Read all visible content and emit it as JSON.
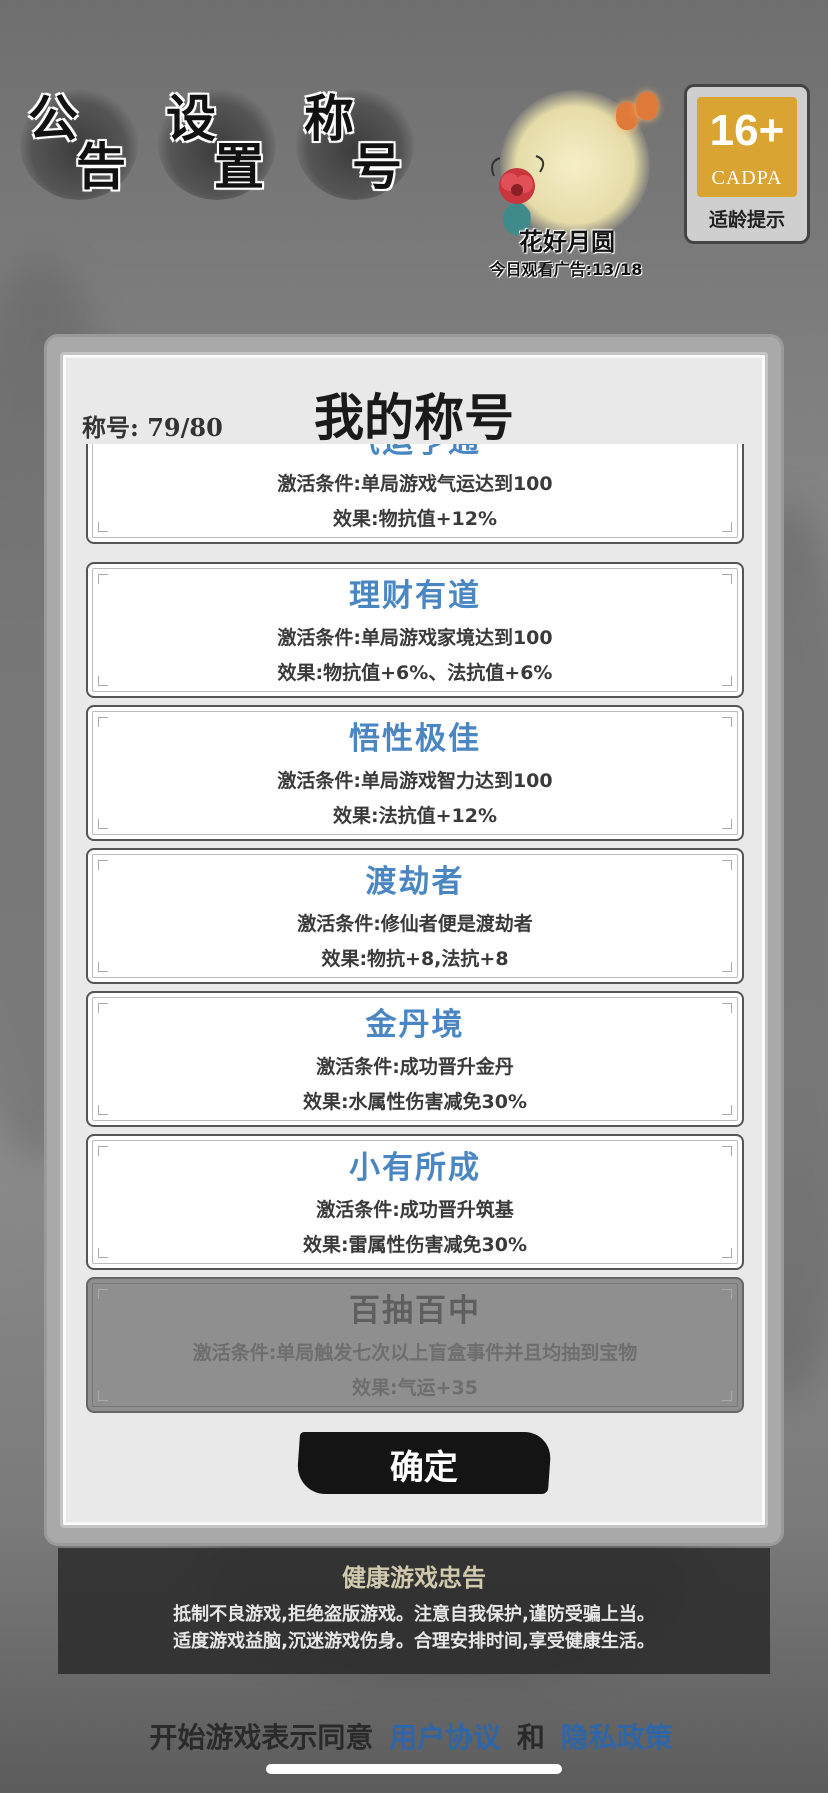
{
  "top_buttons": {
    "announce": {
      "c1": "公",
      "c2": "告"
    },
    "settings": {
      "c1": "设",
      "c2": "置"
    },
    "title": {
      "c1": "称",
      "c2": "号"
    }
  },
  "event": {
    "name": "花好月圆",
    "ad_text": "今日观看广告:13/18"
  },
  "age_badge": {
    "number": "16+",
    "org": "CADPA",
    "hint": "适龄提示",
    "color": "#d9a432"
  },
  "panel": {
    "title": "我的称号",
    "count": "称号: 79/80"
  },
  "titles": [
    {
      "name": "气运亨通",
      "condition": "激活条件:单局游戏气运达到100",
      "effect": "效果:物抗值+12%",
      "locked": false
    },
    {
      "name": "理财有道",
      "condition": "激活条件:单局游戏家境达到100",
      "effect": "效果:物抗值+6%、法抗值+6%",
      "locked": false
    },
    {
      "name": "悟性极佳",
      "condition": "激活条件:单局游戏智力达到100",
      "effect": "效果:法抗值+12%",
      "locked": false
    },
    {
      "name": "渡劫者",
      "condition": "激活条件:修仙者便是渡劫者",
      "effect": "效果:物抗+8,法抗+8",
      "locked": false
    },
    {
      "name": "金丹境",
      "condition": "激活条件:成功晋升金丹",
      "effect": "效果:水属性伤害减免30%",
      "locked": false
    },
    {
      "name": "小有所成",
      "condition": "激活条件:成功晋升筑基",
      "effect": "效果:雷属性伤害减免30%",
      "locked": false
    },
    {
      "name": "百抽百中",
      "condition": "激活条件:单局触发七次以上盲盒事件并且均抽到宝物",
      "effect": "效果:气运+35",
      "locked": true
    }
  ],
  "confirm_label": "确定",
  "advice": {
    "heading": "健康游戏忠告",
    "line1": "抵制不良游戏,拒绝盗版游戏。注意自我保护,谨防受骗上当。",
    "line2": "适度游戏益脑,沉迷游戏伤身。合理安排时间,享受健康生活。"
  },
  "agreement": {
    "prefix": "开始游戏表示同意",
    "user_agreement": "用户协议",
    "and": "和",
    "privacy_policy": "隐私政策"
  },
  "colors": {
    "title_blue": "#4a86c1",
    "link_blue": "#2e66a8",
    "locked_gray": "#8f8f8f"
  }
}
